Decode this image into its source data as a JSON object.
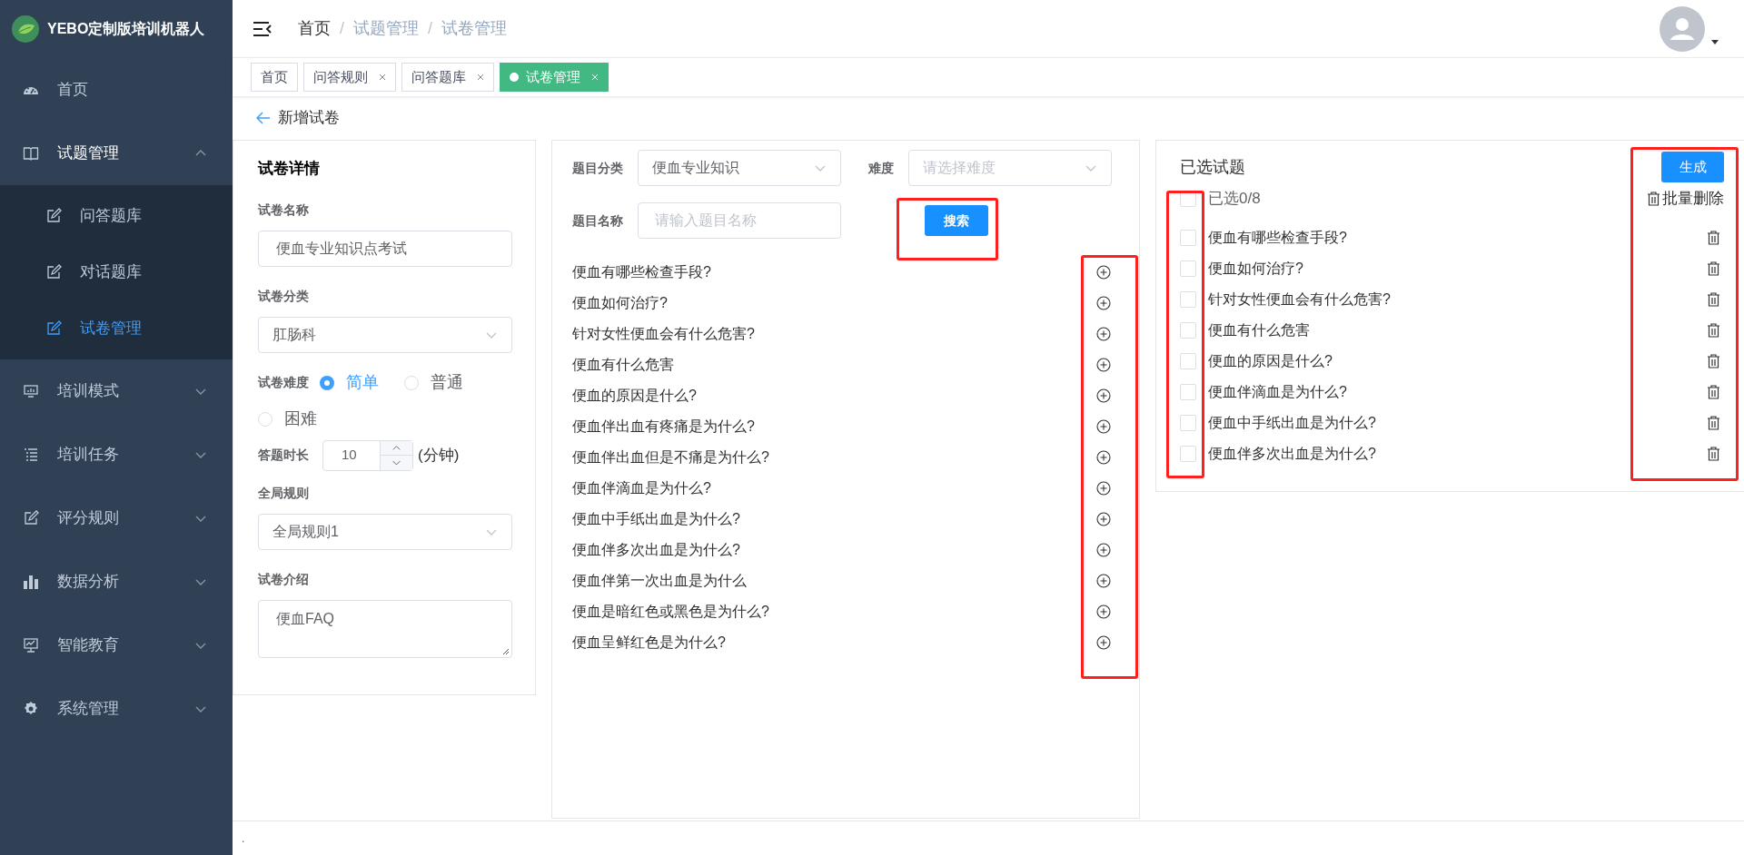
{
  "app": {
    "title": "YEBO定制版培训机器人"
  },
  "sidebar": {
    "items": [
      {
        "label": "首页"
      },
      {
        "label": "试题管理",
        "expanded": true,
        "children": [
          {
            "label": "问答题库",
            "selected": false
          },
          {
            "label": "对话题库",
            "selected": false
          },
          {
            "label": "试卷管理",
            "selected": true
          }
        ]
      },
      {
        "label": "培训模式",
        "expanded": false
      },
      {
        "label": "培训任务",
        "expanded": false
      },
      {
        "label": "评分规则",
        "expanded": false
      },
      {
        "label": "数据分析",
        "expanded": false
      },
      {
        "label": "智能教育",
        "expanded": false
      },
      {
        "label": "系统管理",
        "expanded": false
      }
    ]
  },
  "breadcrumb": [
    {
      "label": "首页"
    },
    {
      "separator": "/",
      "label": "试题管理"
    },
    {
      "separator": "/",
      "label": "试卷管理"
    }
  ],
  "tabs": [
    {
      "label": "首页",
      "selected": false,
      "closable": false
    },
    {
      "label": "问答规则",
      "selected": false,
      "closable": true
    },
    {
      "label": "问答题库",
      "selected": false,
      "closable": true
    },
    {
      "label": "试卷管理",
      "selected": true,
      "closable": true
    }
  ],
  "page_title": "新增试卷",
  "details": {
    "title": "试卷详情",
    "name": {
      "label": "试卷名称",
      "value": "便血专业知识点考试"
    },
    "category": {
      "label": "试卷分类",
      "value": "肛肠科"
    },
    "difficulty": {
      "label": "试卷难度",
      "options": [
        {
          "label": "简单",
          "selected": true
        },
        {
          "label": "普通",
          "selected": false
        },
        {
          "label": "困难",
          "selected": false
        }
      ]
    },
    "duration": {
      "label": "答题时长",
      "value": "10",
      "unit": "(分钟)"
    },
    "rule": {
      "label": "全局规则",
      "value": "全局规则1"
    },
    "intro": {
      "label": "试卷介绍",
      "value": "便血FAQ"
    }
  },
  "filter": {
    "category": {
      "label": "题目分类",
      "value": "便血专业知识"
    },
    "difficulty": {
      "label": "难度",
      "placeholder": "请选择难度"
    },
    "name": {
      "label": "题目名称",
      "placeholder": "请输入题目名称"
    },
    "search_button": "搜索"
  },
  "questions": [
    "便血有哪些检查手段?",
    "便血如何治疗?",
    "针对女性便血会有什么危害?",
    "便血有什么危害",
    "便血的原因是什么?",
    "便血伴出血有疼痛是为什么?",
    "便血伴出血但是不痛是为什么?",
    "便血伴滴血是为什么?",
    "便血中手纸出血是为什么?",
    "便血伴多次出血是为什么?",
    "便血伴第一次出血是为什么",
    "便血是暗红色或黑色是为什么?",
    "便血呈鲜红色是为什么?"
  ],
  "selected_panel": {
    "title": "已选试题",
    "generate_button": "生成",
    "select_all": {
      "label": "已选0/8",
      "checked": false
    },
    "batch_delete": "批量删除",
    "items": [
      {
        "label": "便血有哪些检查手段?",
        "checked": false
      },
      {
        "label": "便血如何治疗?",
        "checked": false
      },
      {
        "label": "针对女性便血会有什么危害?",
        "checked": false
      },
      {
        "label": "便血有什么危害",
        "checked": false
      },
      {
        "label": "便血的原因是什么?",
        "checked": false
      },
      {
        "label": "便血伴滴血是为什么?",
        "checked": false
      },
      {
        "label": "便血中手纸出血是为什么?",
        "checked": false
      },
      {
        "label": "便血伴多次出血是为什么?",
        "checked": false
      }
    ]
  },
  "footer_text": "."
}
